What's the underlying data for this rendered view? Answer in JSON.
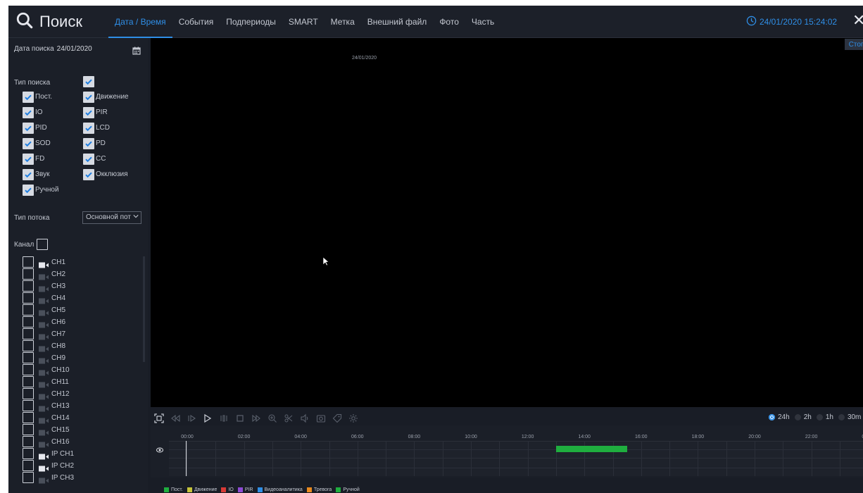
{
  "header": {
    "title": "Поиск",
    "tabs": [
      {
        "label": "Дата / Время",
        "active": true
      },
      {
        "label": "События"
      },
      {
        "label": "Подпериоды"
      },
      {
        "label": "SMART"
      },
      {
        "label": "Метка"
      },
      {
        "label": "Внешний файл"
      },
      {
        "label": "Фото"
      },
      {
        "label": "Часть"
      }
    ],
    "datetime": "24/01/2020 15:24:02",
    "close_label": "✕"
  },
  "left": {
    "search_date_label": "Дата поиска",
    "search_date_value": "24/01/2020",
    "search_type_label": "Тип поиска",
    "types": [
      {
        "label": "Пост.",
        "checked": true
      },
      {
        "label": "Движение",
        "checked": true
      },
      {
        "label": "IO",
        "checked": true
      },
      {
        "label": "PIR",
        "checked": true
      },
      {
        "label": "PID",
        "checked": true
      },
      {
        "label": "LCD",
        "checked": true
      },
      {
        "label": "SOD",
        "checked": true
      },
      {
        "label": "PD",
        "checked": true
      },
      {
        "label": "FD",
        "checked": true
      },
      {
        "label": "CC",
        "checked": true
      },
      {
        "label": "Звук",
        "checked": true
      },
      {
        "label": "Окклюзия",
        "checked": true
      },
      {
        "label": "Ручной",
        "checked": true
      }
    ],
    "stream_type_label": "Тип потока",
    "stream_type_value": "Основной пот",
    "channel_label": "Канал",
    "channels": [
      {
        "label": "CH1",
        "online": true
      },
      {
        "label": "CH2",
        "online": false
      },
      {
        "label": "CH3",
        "online": false
      },
      {
        "label": "CH4",
        "online": false
      },
      {
        "label": "CH5",
        "online": false
      },
      {
        "label": "CH6",
        "online": false
      },
      {
        "label": "CH7",
        "online": false
      },
      {
        "label": "CH8",
        "online": false
      },
      {
        "label": "CH9",
        "online": false
      },
      {
        "label": "CH10",
        "online": false
      },
      {
        "label": "CH11",
        "online": false
      },
      {
        "label": "CH12",
        "online": false
      },
      {
        "label": "CH13",
        "online": false
      },
      {
        "label": "CH14",
        "online": false
      },
      {
        "label": "CH15",
        "online": false
      },
      {
        "label": "CH16",
        "online": false
      },
      {
        "label": "IP CH1",
        "online": true
      },
      {
        "label": "IP CH2",
        "online": true
      },
      {
        "label": "IP CH3",
        "online": false
      }
    ]
  },
  "video": {
    "stop_label": "Стоп"
  },
  "controls": {
    "icons": [
      "fullscreen-icon",
      "rewind-icon",
      "step-back-icon",
      "play-icon",
      "pause-icon",
      "stop-icon",
      "step-forward-icon",
      "zoom-in-icon",
      "crop-icon",
      "volume-icon",
      "snapshot-icon",
      "tag-icon",
      "settings-icon"
    ],
    "zoom_options": [
      {
        "label": "24h",
        "selected": true
      },
      {
        "label": "2h",
        "selected": false
      },
      {
        "label": "1h",
        "selected": false
      },
      {
        "label": "30m",
        "selected": false
      }
    ]
  },
  "timeline": {
    "hours": [
      "00:00",
      "02:00",
      "04:00",
      "06:00",
      "08:00",
      "10:00",
      "12:00",
      "14:00",
      "16:00",
      "18:00",
      "20:00",
      "22:00",
      "00:00"
    ],
    "date": "24/01/2020",
    "recordings": [
      {
        "start_hour": 13.0,
        "end_hour": 15.5,
        "type": "Ручной",
        "color": "#1fae3f"
      }
    ],
    "cursor_hour": 0.0
  },
  "legend": [
    {
      "label": "Пост.",
      "color": "#1fae3f"
    },
    {
      "label": "Движение",
      "color": "#c6c43a"
    },
    {
      "label": "IO",
      "color": "#d83a36"
    },
    {
      "label": "PIR",
      "color": "#8e4ad6"
    },
    {
      "label": "Видеоаналитика",
      "color": "#2f8ee6"
    },
    {
      "label": "Тревога",
      "color": "#ea8a1e"
    },
    {
      "label": "Ручной",
      "color": "#1fae3f"
    }
  ],
  "colors": {
    "accent": "#2f8ee6",
    "background": "#191d26",
    "recording_manual": "#1fae3f"
  }
}
